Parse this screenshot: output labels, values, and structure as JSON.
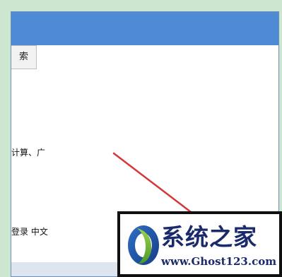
{
  "window": {
    "tab_label": "索",
    "row1_text": "计算、广",
    "row2_text": "登录 中文"
  },
  "watermark": {
    "title": "系统之家",
    "url": "www.Ghost123.com"
  },
  "colors": {
    "background": "#cde6cf",
    "titlebar": "#4f8bd4",
    "arrow": "#d9353a",
    "watermark_text": "#1b2a6b"
  }
}
